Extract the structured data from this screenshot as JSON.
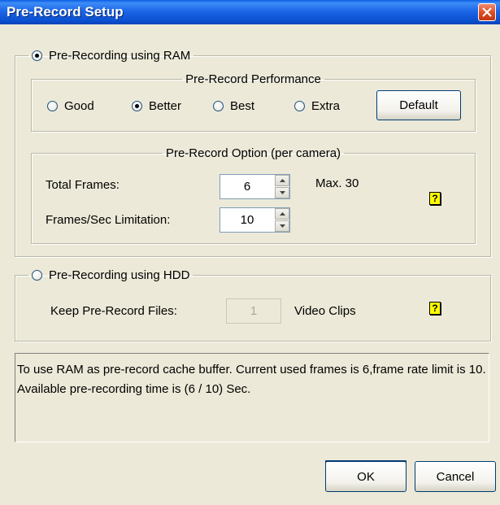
{
  "window": {
    "title": "Pre-Record Setup"
  },
  "ram": {
    "label": "Pre-Recording using RAM",
    "selected": true,
    "performance": {
      "legend": "Pre-Record Performance",
      "options": [
        {
          "label": "Good",
          "selected": false
        },
        {
          "label": "Better",
          "selected": true
        },
        {
          "label": "Best",
          "selected": false
        },
        {
          "label": "Extra",
          "selected": false
        }
      ],
      "default_button": "Default"
    },
    "option": {
      "legend": "Pre-Record Option (per camera)",
      "total_frames_label": "Total Frames:",
      "total_frames_value": "6",
      "max_label": "Max. 30",
      "fps_label": "Frames/Sec Limitation:",
      "fps_value": "10",
      "help_icon": "question-mark-icon",
      "help_text": "?"
    }
  },
  "hdd": {
    "label": "Pre-Recording using HDD",
    "selected": false,
    "keep_label": "Keep Pre-Record Files:",
    "keep_value": "1",
    "unit_label": "Video Clips",
    "help_icon": "question-mark-icon",
    "help_text": "?"
  },
  "info_text": "To use RAM as pre-record cache buffer. Current used frames is 6,frame rate limit is 10. Available pre-recording time is (6 / 10) Sec.",
  "buttons": {
    "ok": "OK",
    "cancel": "Cancel"
  }
}
